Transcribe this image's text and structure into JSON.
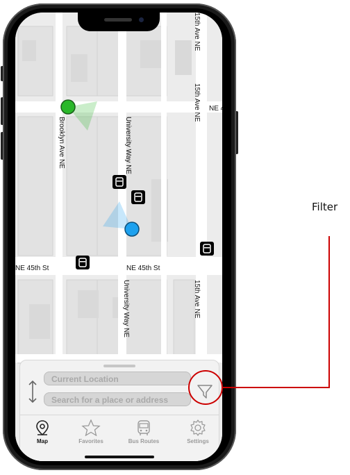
{
  "map": {
    "streets": {
      "ne_45th_left": "NE 45th St",
      "ne_45th_right": "NE 45th St",
      "brooklyn": "Brooklyn Ave NE",
      "university_upper": "University Way NE",
      "university_lower": "University Way NE",
      "ave15_top": "15th Ave NE",
      "ave15_mid": "15th Ave NE",
      "ave15_lower": "15th Ave NE",
      "ne4_partial": "NE 4"
    },
    "markers": {
      "user_color": "#1ea1ee",
      "bus_color": "#2ab82a"
    }
  },
  "search": {
    "from_placeholder": "Current Location",
    "to_placeholder": "Search for a place or address"
  },
  "tabs": [
    {
      "label": "Map",
      "icon": "map-pin-icon",
      "active": true
    },
    {
      "label": "Favorites",
      "icon": "star-icon",
      "active": false
    },
    {
      "label": "Bus Routes",
      "icon": "bus-icon",
      "active": false
    },
    {
      "label": "Settings",
      "icon": "gear-icon",
      "active": false
    }
  ],
  "annotation": {
    "label": "Filter",
    "color": "#cc0000"
  }
}
